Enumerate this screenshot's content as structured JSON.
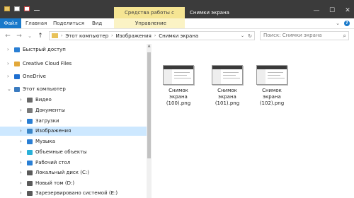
{
  "titlebar": {
    "context_tab_group": "Средства работы с рисунками",
    "window_title": "Снимки экрана",
    "minimize": "—",
    "maximize": "☐",
    "close": "✕"
  },
  "ribbon": {
    "tabs": [
      "Файл",
      "Главная",
      "Поделиться",
      "Вид",
      "Управление"
    ],
    "collapse_glyph": "⌄",
    "help_glyph": "?"
  },
  "addressbar": {
    "back": "←",
    "forward": "→",
    "recent": "⌄",
    "up": "↑",
    "crumbs": [
      "Этот компьютер",
      "Изображения",
      "Снимки экрана"
    ],
    "sep_glyph": "›",
    "dropdown_glyph": "⌄",
    "refresh_glyph": "↻",
    "search_placeholder": "Поиск: Снимки экрана",
    "search_glyph": "⌕"
  },
  "nav": {
    "items": [
      {
        "label": "Быстрый доступ",
        "icon": "star-icon",
        "color": "#2a7fd4",
        "indent": 0,
        "arrow": "›"
      },
      {
        "label": "Creative Cloud Files",
        "icon": "creative-cloud-icon",
        "color": "#e2a83a",
        "indent": 0,
        "arrow": "›"
      },
      {
        "label": "OneDrive",
        "icon": "cloud-icon",
        "color": "#1f6fd0",
        "indent": 0,
        "arrow": "›"
      },
      {
        "label": "Этот компьютер",
        "icon": "computer-icon",
        "color": "#3b7bc0",
        "indent": 0,
        "arrow": "⌄"
      },
      {
        "label": "Видео",
        "icon": "video-icon",
        "color": "#6a6a6a",
        "indent": 1,
        "arrow": "›"
      },
      {
        "label": "Документы",
        "icon": "documents-icon",
        "color": "#7a7a7a",
        "indent": 1,
        "arrow": "›"
      },
      {
        "label": "Загрузки",
        "icon": "downloads-icon",
        "color": "#2a7fd4",
        "indent": 1,
        "arrow": "›"
      },
      {
        "label": "Изображения",
        "icon": "pictures-icon",
        "color": "#3a86c8",
        "indent": 1,
        "arrow": "›",
        "selected": true
      },
      {
        "label": "Музыка",
        "icon": "music-icon",
        "color": "#2a7fd4",
        "indent": 1,
        "arrow": "›"
      },
      {
        "label": "Объемные объекты",
        "icon": "3d-objects-icon",
        "color": "#2ab0d8",
        "indent": 1,
        "arrow": "›"
      },
      {
        "label": "Рабочий стол",
        "icon": "desktop-icon",
        "color": "#2a7fd4",
        "indent": 1,
        "arrow": "›"
      },
      {
        "label": "Локальный диск (C:)",
        "icon": "drive-icon",
        "color": "#5a5a5a",
        "indent": 1,
        "arrow": "›"
      },
      {
        "label": "Новый том (D:)",
        "icon": "drive-icon",
        "color": "#5a5a5a",
        "indent": 1,
        "arrow": "›"
      },
      {
        "label": "Зарезервировано системой (E:)",
        "icon": "drive-icon",
        "color": "#5a5a5a",
        "indent": 1,
        "arrow": "›"
      }
    ]
  },
  "files": [
    {
      "name": "Снимок экрана (100).png"
    },
    {
      "name": "Снимок экрана (101).png"
    },
    {
      "name": "Снимок экрана (102).png"
    }
  ],
  "colors": {
    "accent": "#1979ca",
    "selected_row": "#cde8ff",
    "context_tab": "#f5e38a"
  }
}
